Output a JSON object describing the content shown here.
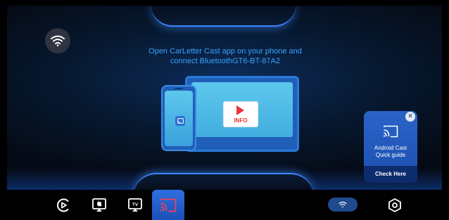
{
  "instruction": {
    "line1": "Open CarLetter Cast app on your phone and",
    "line2": "connect BluetoothGT6-BT-87A2"
  },
  "illustration": {
    "info_label": "INFO"
  },
  "guide": {
    "title_line1": "Android Cast",
    "title_line2": "Quick guide",
    "button_label": "Check Here",
    "close_glyph": "×"
  },
  "dock": {
    "items": [
      {
        "name": "carplay-icon"
      },
      {
        "name": "airplay-apple-icon"
      },
      {
        "name": "apple-tv-icon"
      },
      {
        "name": "android-cast-icon",
        "active": true
      },
      {
        "name": "wifi-status-icon"
      },
      {
        "name": "settings-hexagon-icon"
      }
    ]
  },
  "colors": {
    "accent": "#38a3ff",
    "active_tab": "#2f6fe0",
    "guide_card": "#2a63c9",
    "info_red": "#e8343a"
  }
}
